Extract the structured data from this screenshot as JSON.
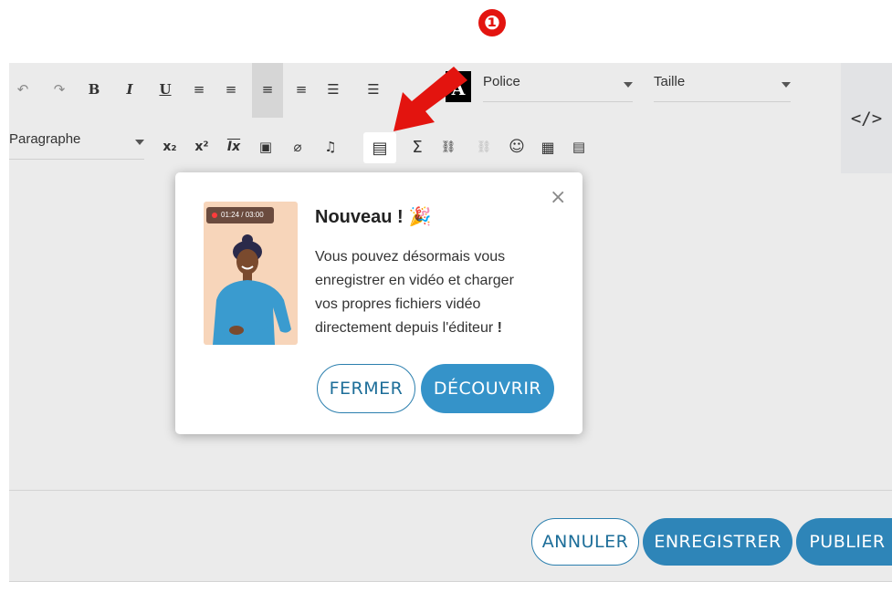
{
  "annotation": {
    "number": "❶",
    "color": "#e3140f"
  },
  "toolbar": {
    "row1": {
      "undo": "↶",
      "redo": "↷",
      "bold": "B",
      "italic": "I",
      "underline": "U",
      "align_justify": "≡",
      "align_center": "≡",
      "align_left": "≡",
      "align_right": "≡",
      "bullet_list": "☰",
      "numbered_list": "☰",
      "text_color": "A",
      "font_select": "Police",
      "size_select": "Taille"
    },
    "row2": {
      "paragraph_select": "Paragraphe",
      "subscript": "x₂",
      "superscript": "x²",
      "clear_format": "Ix",
      "image": "▣",
      "attachment": "⌀",
      "audio": "♫",
      "video": "▤",
      "formula": "Σ",
      "link": "⛓",
      "unlink": "⛓",
      "emoji": "☺",
      "table": "▦",
      "template": "▤"
    },
    "code_view": "</>"
  },
  "modal": {
    "title": "Nouveau !",
    "party_icon": "🎉",
    "body_line1": "Vous pouvez désormais vous",
    "body_line2": "enregistrer en vidéo et charger",
    "body_line3": "vos propres fichiers vidéo",
    "body_line4": "directement depuis l'éditeur",
    "body_excl": "!",
    "close": "×",
    "recording_time": "01:24 / 03:00",
    "button_close": "FERMER",
    "button_discover": "DÉCOUVRIR"
  },
  "footer": {
    "cancel": "ANNULER",
    "save": "ENREGISTRER",
    "publish": "PUBLIER"
  },
  "colors": {
    "accent": "#2e85b8",
    "arrow": "#e3140f",
    "editor_bg": "#ebebeb"
  }
}
